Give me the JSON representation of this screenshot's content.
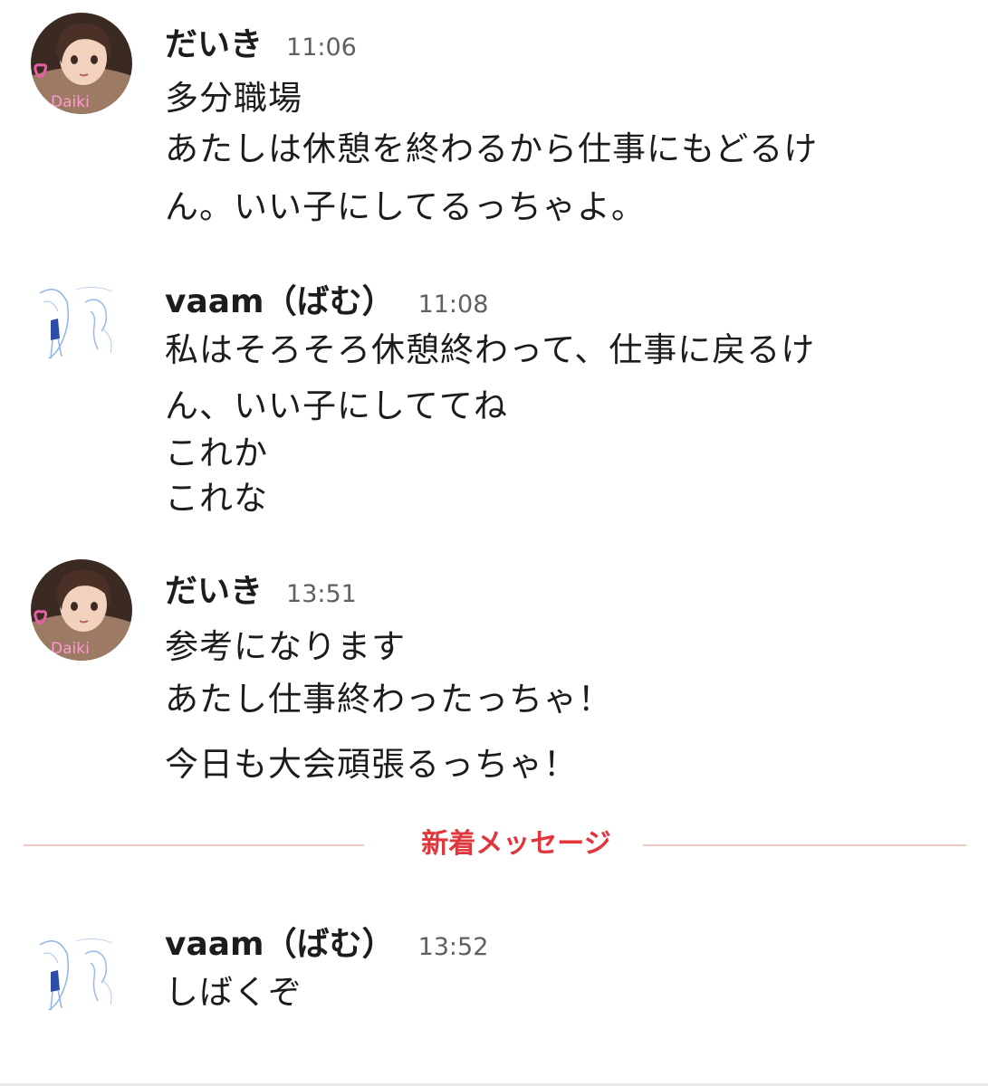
{
  "divider_label": "新着メッセージ",
  "colors": {
    "divider_text": "#e0363c",
    "divider_line": "#f3c6c6",
    "name": "#1d1c1d",
    "time": "#616061"
  },
  "avatar_watermark": "Daiki",
  "messages": [
    {
      "author": "だいき",
      "time": "11:06",
      "avatar": "anime-girl-avatar",
      "lines": [
        "多分職場",
        "あたしは休憩を終わるから仕事にもどるけ",
        "ん。いい子にしてるっちゃよ。"
      ]
    },
    {
      "author": "vaam（ばむ）",
      "time": "11:08",
      "avatar": "sketch-avatar",
      "lines": [
        "私はそろそろ休憩終わって、仕事に戻るけ",
        "ん、いい子にしててね",
        "これか",
        "これな"
      ]
    },
    {
      "author": "だいき",
      "time": "13:51",
      "avatar": "anime-girl-avatar",
      "lines": [
        "参考になります",
        "あたし仕事終わったっちゃ！",
        "今日も大会頑張るっちゃ！"
      ]
    },
    {
      "author": "vaam（ばむ）",
      "time": "13:52",
      "avatar": "sketch-avatar",
      "lines": [
        "しばくぞ"
      ]
    }
  ]
}
